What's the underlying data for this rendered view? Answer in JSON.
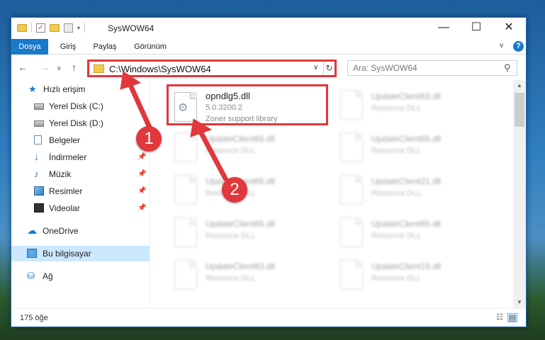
{
  "window": {
    "title": "SysWOW64",
    "controls": {
      "minimize": "—",
      "maximize": "☐",
      "close": "✕"
    }
  },
  "ribbon": {
    "tabs": [
      "Dosya",
      "Giriş",
      "Paylaş",
      "Görünüm"
    ],
    "help": "?"
  },
  "navigation": {
    "address_path": "C:\\Windows\\SysWOW64",
    "search_placeholder": "Ara: SysWOW64"
  },
  "sidebar": {
    "items": [
      {
        "label": "Hızlı erişim",
        "icon": "star-icon",
        "pinned": false
      },
      {
        "label": "Yerel Disk (C:)",
        "icon": "drive-icon",
        "pinned": false
      },
      {
        "label": "Yerel Disk (D:)",
        "icon": "drive-icon",
        "pinned": false
      },
      {
        "label": "Belgeler",
        "icon": "document-icon",
        "pinned": true
      },
      {
        "label": "İndirmeler",
        "icon": "download-icon",
        "pinned": true
      },
      {
        "label": "Müzik",
        "icon": "music-icon",
        "pinned": true
      },
      {
        "label": "Resimler",
        "icon": "pictures-icon",
        "pinned": true
      },
      {
        "label": "Videolar",
        "icon": "videos-icon",
        "pinned": true
      },
      {
        "label": "OneDrive",
        "icon": "cloud-icon",
        "pinned": false
      },
      {
        "label": "Bu bilgisayar",
        "icon": "computer-icon",
        "pinned": false,
        "selected": true
      },
      {
        "label": "Ağ",
        "icon": "network-icon",
        "pinned": false
      }
    ]
  },
  "files": [
    {
      "name": "opndlg5.dll",
      "version": "5.0.3200.2",
      "description": "Zoner support library",
      "highlighted": true
    },
    {
      "name": "UpdateClient63.dll",
      "description": "Resource DLL"
    },
    {
      "name": "UpdateClient65.dll",
      "description": "Resource DLL"
    },
    {
      "name": "UpdateClient65.dll",
      "description": "Resource DLL"
    },
    {
      "name": "UpdateClient65.dll",
      "description": "Resource DLL"
    },
    {
      "name": "UpdateClient21.dll",
      "description": "Resource DLL"
    },
    {
      "name": "UpdateClient65.dll",
      "description": "Resource DLL"
    },
    {
      "name": "UpdateClient65.dll",
      "description": "Resource DLL"
    },
    {
      "name": "UpdateClient63.dll",
      "description": "Resource DLL"
    },
    {
      "name": "UpdateClient19.dll",
      "description": "Resource DLL"
    }
  ],
  "status": {
    "item_count": "175 öğe"
  },
  "callouts": [
    "1",
    "2"
  ],
  "colors": {
    "accent": "#1979ca",
    "highlight": "#e0383c",
    "selection": "#cce8ff"
  }
}
